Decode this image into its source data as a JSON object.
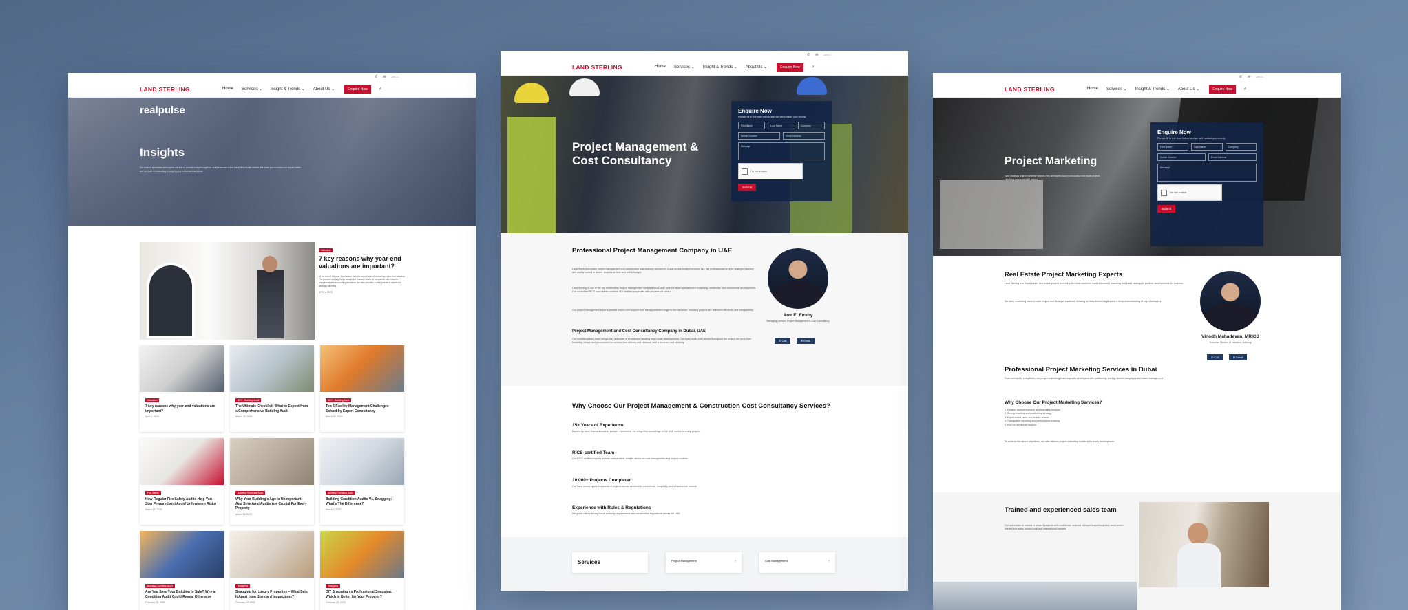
{
  "common": {
    "logo": "LAND STERLING",
    "nav": [
      "Home",
      "Services ⌄",
      "Insight & Trends ⌄",
      "About Us ⌄"
    ],
    "enquire_btn": "Enquire Now",
    "util_text": "+971 4 ..."
  },
  "insights": {
    "brand": "realpulse",
    "title": "Insights",
    "intro": "Our team of specialists and experts are able to provide in-depth insight on multiple sectors in the Saudi Real Estate Market. We strive you to receive our reports better and we have an interesting in keeping your investment decisions.",
    "featured": {
      "tag": "Valuation",
      "title": "7 key reasons why year-end valuations are important?",
      "date": "APR 1, 2025"
    },
    "cards": [
      {
        "tag": "Valuation",
        "title": "7 key reasons why year-end valuations are important?",
        "date": "April 1, 2025"
      },
      {
        "tag": "BFC - Building Audit",
        "title": "The Ultimate Checklist: What to Expect from a Comprehensive Building Audit",
        "date": "March 28, 2025"
      },
      {
        "tag": "BFC - Building Audit",
        "title": "Top 5 Facility Management Challenges Solved by Expert Consultancy",
        "date": "March 20, 2025"
      },
      {
        "tag": "Fire Safety",
        "title": "How Regular Fire Safety Audits Help You Stay Prepared and Avoid Unforeseen Risks",
        "date": "March 15, 2025"
      },
      {
        "tag": "Building Structural Audit",
        "title": "Why Your Building's Age Is Unimportant And Structural Audits Are Crucial For Every Property",
        "date": "March 11, 2025"
      },
      {
        "tag": "Building Condition Audit",
        "title": "Building Condition Audits Vs. Snagging: What's The Difference?",
        "date": "March 7, 2025"
      },
      {
        "tag": "Building Condition Audit",
        "title": "Are You Sure Your Building Is Safe? Why a Condition Audit Could Reveal Otherwise",
        "date": "February 28, 2025"
      },
      {
        "tag": "Snagging",
        "title": "Snagging for Luxury Properties – What Sets It Apart from Standard Inspections?",
        "date": "February 22, 2025"
      },
      {
        "tag": "Snagging",
        "title": "DIY Snagging vs Professional Snagging: Which is Better for Your Property?",
        "date": "February 15, 2025"
      }
    ]
  },
  "pm": {
    "hero_title": "Project Management & Cost Consultancy",
    "form": {
      "title": "Enquire Now",
      "subtitle": "Please fill in the form below and we will contact you shortly",
      "first": "First Name",
      "last": "Last Name",
      "company": "Company",
      "mobile": "Mobile Number",
      "email": "Email Address",
      "message": "Message",
      "captcha": "I'm not a robot",
      "submit": "Submit"
    },
    "h1": "Professional Project Management Company in UAE",
    "p1": "Land Sterling provides project management and construction cost advisory services in Dubai across multiple sectors. Our key professionals bring in strategic planning and quality control to deliver projects on time and within budget.",
    "p2": "Land Sterling is one of the top construction project management companies in Dubai, with the team specialized in hospitality, residential, and commercial developments. Our accredited RICS consultants combine ISO certified processes with proven cost control.",
    "p3": "Our project management experts provide end-to-end support from the appointment stage to the handover, ensuring projects are delivered efficiently and transparently.",
    "h2": "Project Management and Cost Consultancy Company in Dubai, UAE",
    "p4": "Our multidisciplinary team brings over a decade of experience handling large-scale developments. Our team works with clients throughout the project life cycle from feasibility, design and procurement to construction delivery and closeout, with a focus on cost certainty.",
    "person": {
      "name": "Amr El Etreby",
      "role": "Managing Director, Project Management & Cost Consultancy",
      "call": "Call",
      "email": "Email"
    },
    "why_title": "Why Choose Our Project Management & Construction Cost Consultancy Services?",
    "why": [
      {
        "h": "15+ Years of Experience",
        "p": "Backed by more than a decade of industry experience, we bring deep knowledge of the UAE market to every project."
      },
      {
        "h": "RICS-certified Team",
        "p": "Our RICS-certified experts provide independent, reliable advice on cost management and project controls."
      },
      {
        "h": "10,000+ Projects Completed",
        "p": "Our track record spans thousands of projects across residential, commercial, hospitality and infrastructure sectors."
      },
      {
        "h": "Experience with Rules & Regulations",
        "p": "We guide clients through local authority requirements and construction regulations across the UAE."
      }
    ],
    "services_title": "Services",
    "svc": [
      "Project Management",
      "Cost Management"
    ]
  },
  "mk": {
    "hero_title": "Project Marketing",
    "hero_text": "Land Sterling's project marketing services help developers launch and position real estate projects effectively across the UAE market.",
    "form": {
      "title": "Enquire Now",
      "subtitle": "Please fill in the form below and we will contact you shortly",
      "first": "First Name",
      "last": "Last Name",
      "company": "Company",
      "mobile": "Mobile Number",
      "email": "Email Address",
      "message": "Message",
      "captcha": "I'm not a robot",
      "submit": "Submit"
    },
    "h1": "Real Estate Project Marketing Experts",
    "p1": "Land Sterling is a Dubai-based real estate project marketing firm that combines market research, branding and sales strategy to position developments for success.",
    "p2": "We tailor marketing plans to each project and its target audience, drawing on data-driven insights and a deep understanding of buyer behaviour.",
    "person": {
      "name": "Vinodh Mahadevan, MRICS",
      "role": "Executive Director of Valuation, Advisory",
      "call": "Call",
      "email": "Email"
    },
    "h2": "Professional Project Marketing Services in Dubai",
    "p3": "From concept to completion, our project marketing team supports developers with positioning, pricing, launch campaigns and sales management.",
    "h3": "Why Choose Our Project Marketing Services?",
    "list": [
      "1. Detailed market research and feasibility analysis",
      "2. Strong branding and positioning strategy",
      "3. Experienced sales and broker network",
      "4. Transparent reporting and performance tracking",
      "5. End-to-end launch support"
    ],
    "p4": "To achieve the above objectives, we offer tailored project marketing solutions for every development.",
    "sales_title": "Trained and experienced sales team",
    "sales_text": "Our sales team is trained to present projects with confidence, respond to buyer enquiries quickly and convert interest into sales across local and international markets."
  }
}
